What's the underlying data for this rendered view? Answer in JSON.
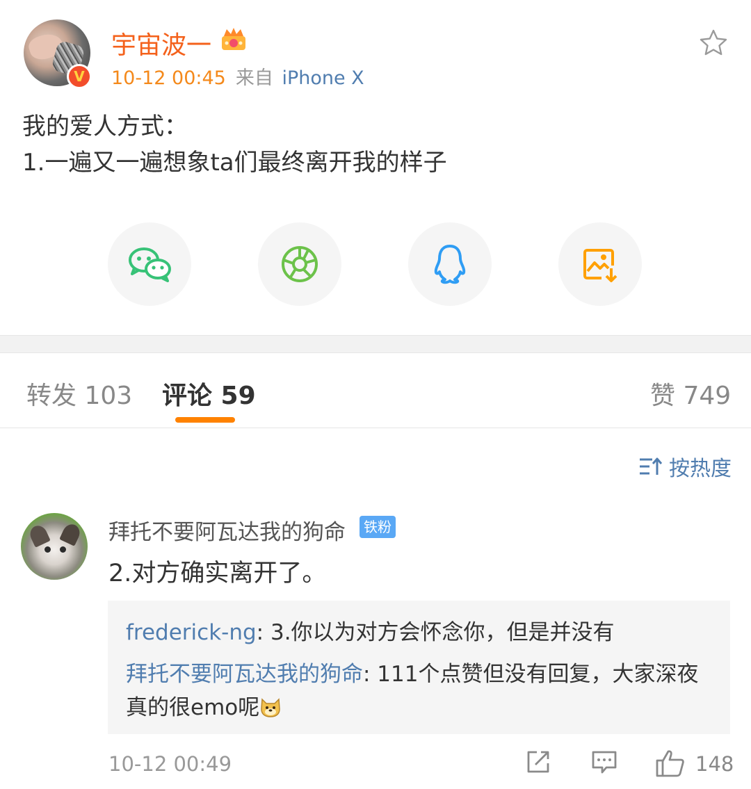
{
  "post": {
    "username": "宇宙波一",
    "time": "10-12 00:45",
    "from_label": "来自",
    "device": "iPhone X",
    "verify_badge": "V",
    "text_line1": "我的爱人方式：",
    "text_line2": "1.一遍又一遍想象ta们最终离开我的样子",
    "icons": {
      "member": "crown-icon",
      "favorite": "star-icon"
    }
  },
  "share": [
    {
      "name": "wechat-icon",
      "color": "#37c277"
    },
    {
      "name": "moments-icon",
      "color": "#6cc24a"
    },
    {
      "name": "qq-icon",
      "color": "#2f9df4"
    },
    {
      "name": "save-image-icon",
      "color": "#ffa000"
    }
  ],
  "tabs": {
    "repost": "转发 103",
    "comments": "评论 59",
    "likes": "赞 749",
    "accent": "#ff8200"
  },
  "sort": {
    "label": "按热度"
  },
  "comment": {
    "user": "拜托不要阿瓦达我的狗命",
    "badge": "铁粉",
    "text": "2.对方确实离开了。",
    "replies": [
      {
        "user": "frederick-ng",
        "text": ": 3.你以为对方会怀念你，但是并没有"
      },
      {
        "user": "拜托不要阿瓦达我的狗命",
        "text": ": 111个点赞但没有回复，大家深夜真的很emo呢"
      }
    ],
    "time": "10-12 00:49",
    "like_count": "148"
  },
  "colors": {
    "link": "#507daf",
    "username": "#f4611b",
    "time": "#f4891b"
  }
}
